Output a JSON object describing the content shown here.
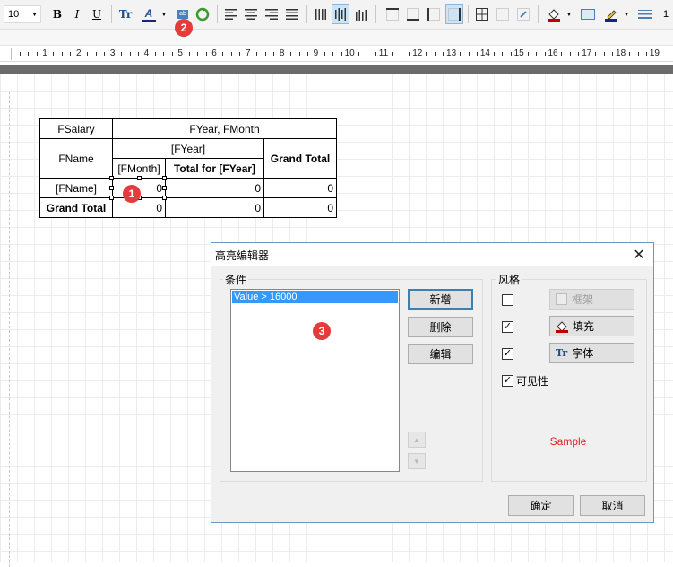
{
  "toolbar": {
    "font_size": "10",
    "bold": "B",
    "italic": "I",
    "underline": "U",
    "font_icon": "Tr",
    "font_color": "A",
    "highlight_button": "ab"
  },
  "ruler": {
    "numbers": [
      "1",
      "2",
      "3",
      "4",
      "5",
      "6",
      "7",
      "8",
      "9",
      "10",
      "11",
      "12",
      "13",
      "14",
      "15",
      "16",
      "17",
      "18",
      "19"
    ]
  },
  "pivot": {
    "salary_header": "FSalary",
    "columns_header": "FYear, FMonth",
    "row_field": "FName",
    "year_field": "[FYear]",
    "month_field": "[FMonth]",
    "total_year": "Total for [FYear]",
    "grand_total_col": "Grand Total",
    "name_value": "[FName]",
    "grand_total_row": "Grand Total",
    "row1": [
      "0",
      "0",
      "0"
    ],
    "row2": [
      "0",
      "0",
      "0"
    ]
  },
  "badges": {
    "one": "1",
    "two": "2",
    "three": "3"
  },
  "dialog": {
    "title": "高亮编辑器",
    "close": "✕",
    "conditions_label": "条件",
    "conditions": [
      "Value > 16000"
    ],
    "add": "新增",
    "delete": "删除",
    "edit": "编辑",
    "style_label": "风格",
    "frame": "框架",
    "fill": "填充",
    "font": "字体",
    "visibility": "可见性",
    "sample": "Sample",
    "ok": "确定",
    "cancel": "取消",
    "checks": {
      "frame": false,
      "fill": true,
      "font": true,
      "visibility": true
    },
    "check_mark": "✓"
  },
  "colors": {
    "badge": "#e43b3b",
    "sample_text": "#e02020",
    "selection": "#3399ff",
    "dialog_border": "#6d97c2"
  }
}
